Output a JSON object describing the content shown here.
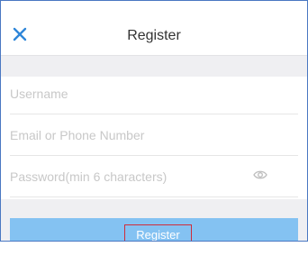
{
  "header": {
    "title": "Register",
    "close_icon": "close-icon",
    "accent_color": "#2f86d9"
  },
  "form": {
    "username_placeholder": "Username",
    "contact_placeholder": "Email or Phone Number",
    "password_placeholder": "Password(min 6 characters)",
    "toggle_icon": "eye-icon"
  },
  "actions": {
    "register_label": "Register",
    "button_color": "#84c2f2"
  }
}
